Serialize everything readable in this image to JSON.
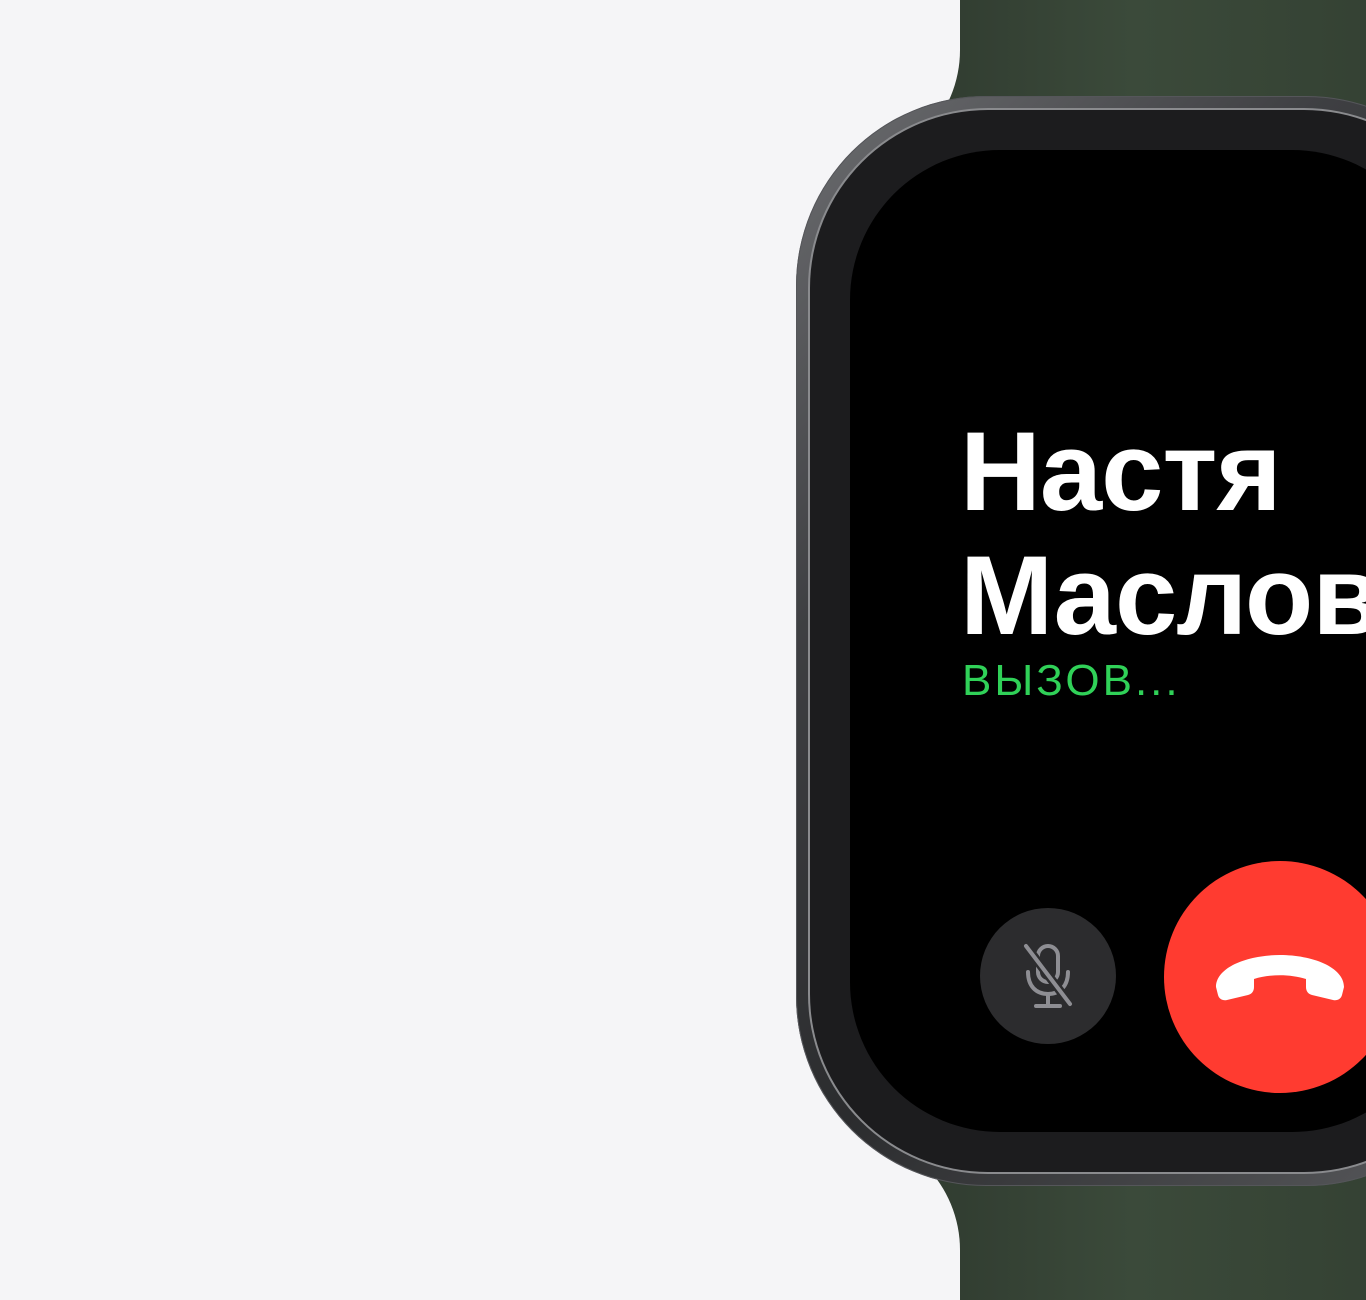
{
  "call": {
    "contact_first_name": "Настя",
    "contact_last_name": "Маслова",
    "status": "ВЫЗОВ..."
  },
  "controls": {
    "mute_icon": "microphone-slash-icon",
    "end_icon": "phone-hang-up-icon"
  },
  "colors": {
    "background": "#f5f5f7",
    "screen": "#000000",
    "name_text": "#ffffff",
    "status_text": "#30d158",
    "end_button": "#ff3b30",
    "mute_button": "#2c2c2e",
    "band": "#3b4a3a"
  }
}
